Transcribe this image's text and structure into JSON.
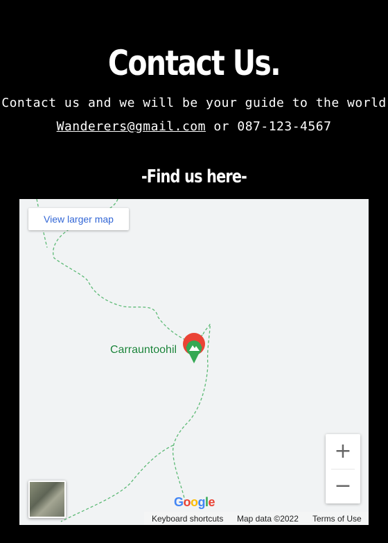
{
  "header": {
    "title": "Contact Us.",
    "subtitle": "Contact us and we will be your guide to the world",
    "email": "Wanderers@gmail.com",
    "separator": "or",
    "phone": "087-123-4567"
  },
  "find_us": "-Find us here-",
  "map": {
    "view_larger_label": "View larger map",
    "place_name": "Carrauntoohil",
    "zoom_in_label": "+",
    "zoom_out_label": "−",
    "google_logo": [
      "G",
      "o",
      "o",
      "g",
      "l",
      "e"
    ],
    "keyboard_shortcuts": "Keyboard shortcuts",
    "map_data": "Map data ©2022",
    "terms": "Terms of Use",
    "colors": {
      "trail": "#5bb974",
      "marker_red": "#ea4335",
      "marker_green": "#34a853",
      "label_green": "#188038",
      "link_blue": "#3367d6"
    }
  }
}
